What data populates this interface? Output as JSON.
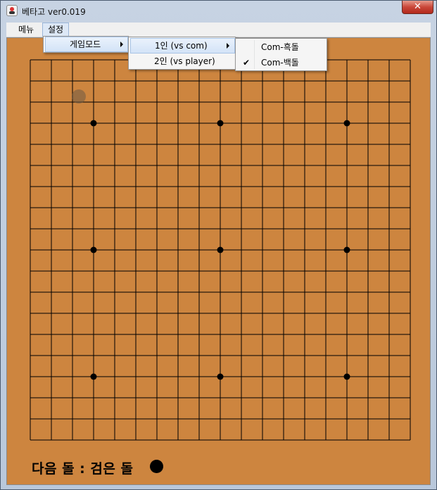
{
  "window": {
    "title": "베타고 ver0.019",
    "close_label": "✕"
  },
  "menubar": {
    "items": [
      {
        "label": "메뉴"
      },
      {
        "label": "설정"
      }
    ]
  },
  "settings_menu": {
    "items": [
      {
        "label": "게임모드",
        "has_submenu": true
      }
    ]
  },
  "gamemode_menu": {
    "items": [
      {
        "label": "1인 (vs com)",
        "has_submenu": true
      },
      {
        "label": "2인 (vs player)",
        "has_submenu": false
      }
    ]
  },
  "com_menu": {
    "items": [
      {
        "label": "Com-흑돌",
        "checked": false
      },
      {
        "label": "Com-백돌",
        "checked": true
      }
    ]
  },
  "board": {
    "size": 19,
    "star_points": [
      [
        3,
        3
      ],
      [
        9,
        3
      ],
      [
        15,
        3
      ],
      [
        3,
        9
      ],
      [
        9,
        9
      ],
      [
        15,
        9
      ],
      [
        3,
        15
      ],
      [
        9,
        15
      ],
      [
        15,
        15
      ]
    ],
    "colors": {
      "wood": "#cd853f",
      "line": "#000000"
    }
  },
  "status": {
    "text": "다음 돌 : 검은 돌",
    "next_stone": "black"
  }
}
